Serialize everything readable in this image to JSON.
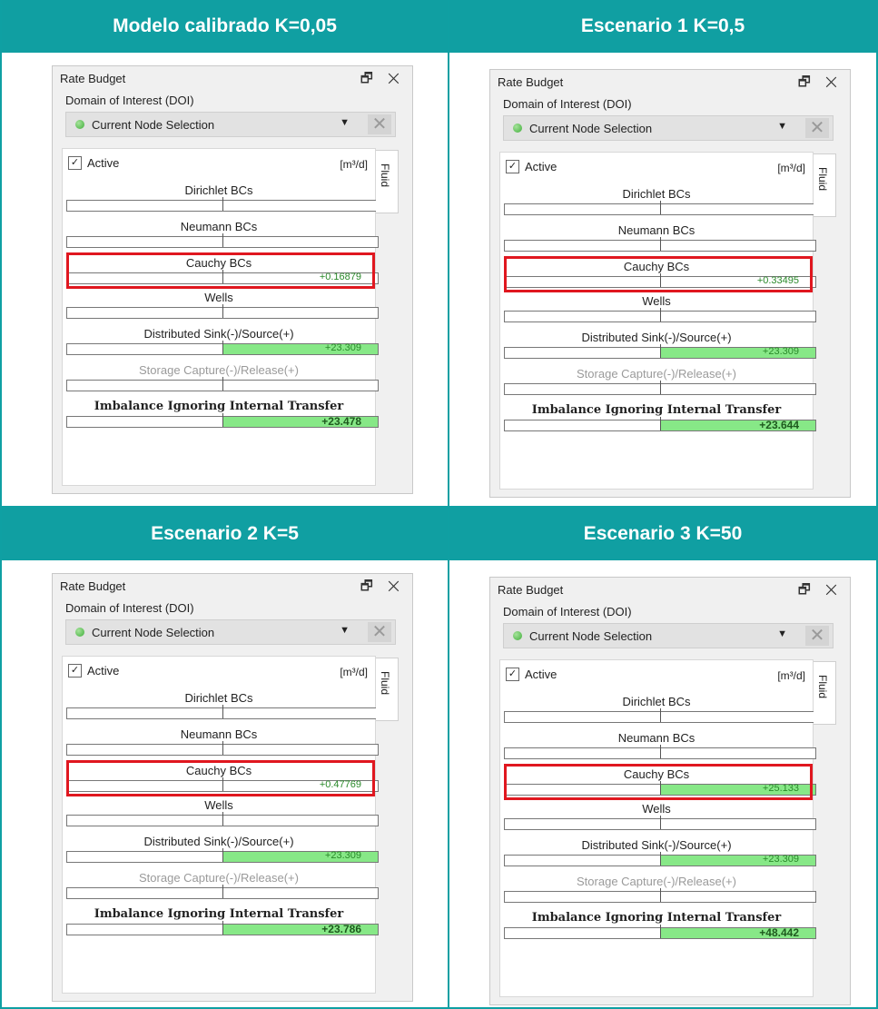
{
  "panels": [
    {
      "heading": "Modelo calibrado K=0,05",
      "title": "Rate Budget",
      "icons": "🗗 ✕",
      "doi_label": "Domain of Interest (DOI)",
      "selection": "Current Node Selection",
      "active_label": "Active",
      "unit": "[m³/d]",
      "tab": "Fluid",
      "sections": {
        "dirichlet": {
          "label": "Dirichlet BCs",
          "value": "",
          "fraction": 0
        },
        "neumann": {
          "label": "Neumann BCs",
          "value": "",
          "fraction": 0
        },
        "cauchy": {
          "label": "Cauchy BCs",
          "value": "+0.16879",
          "fraction": 0
        },
        "wells": {
          "label": "Wells",
          "value": "",
          "fraction": 0
        },
        "distributed": {
          "label": "Distributed Sink(-)/Source(+)",
          "value": "+23.309",
          "fraction": 1
        },
        "storage": {
          "label": "Storage Capture(-)/Release(+)",
          "value": "",
          "fraction": 0
        },
        "imbalance": {
          "label": "Imbalance Ignoring Internal Transfer",
          "value": "+23.478",
          "fraction": 1
        }
      }
    },
    {
      "heading": "Escenario 1 K=0,5",
      "title": "Rate Budget",
      "icons": "🗗 ✕",
      "doi_label": "Domain of Interest (DOI)",
      "selection": "Current Node Selection",
      "active_label": "Active",
      "unit": "[m³/d]",
      "tab": "Fluid",
      "sections": {
        "dirichlet": {
          "label": "Dirichlet BCs",
          "value": "",
          "fraction": 0
        },
        "neumann": {
          "label": "Neumann BCs",
          "value": "",
          "fraction": 0
        },
        "cauchy": {
          "label": "Cauchy BCs",
          "value": "+0.33495",
          "fraction": 0
        },
        "wells": {
          "label": "Wells",
          "value": "",
          "fraction": 0
        },
        "distributed": {
          "label": "Distributed Sink(-)/Source(+)",
          "value": "+23.309",
          "fraction": 1
        },
        "storage": {
          "label": "Storage Capture(-)/Release(+)",
          "value": "",
          "fraction": 0
        },
        "imbalance": {
          "label": "Imbalance Ignoring Internal Transfer",
          "value": "+23.644",
          "fraction": 1
        }
      }
    },
    {
      "heading": "Escenario 2 K=5",
      "title": "Rate Budget",
      "icons": "🗗 ✕",
      "doi_label": "Domain of Interest (DOI)",
      "selection": "Current Node Selection",
      "active_label": "Active",
      "unit": "[m³/d]",
      "tab": "Fluid",
      "sections": {
        "dirichlet": {
          "label": "Dirichlet BCs",
          "value": "",
          "fraction": 0
        },
        "neumann": {
          "label": "Neumann BCs",
          "value": "",
          "fraction": 0
        },
        "cauchy": {
          "label": "Cauchy BCs",
          "value": "+0.47769",
          "fraction": 0
        },
        "wells": {
          "label": "Wells",
          "value": "",
          "fraction": 0
        },
        "distributed": {
          "label": "Distributed Sink(-)/Source(+)",
          "value": "+23.309",
          "fraction": 1
        },
        "storage": {
          "label": "Storage Capture(-)/Release(+)",
          "value": "",
          "fraction": 0
        },
        "imbalance": {
          "label": "Imbalance Ignoring Internal Transfer",
          "value": "+23.786",
          "fraction": 1
        }
      }
    },
    {
      "heading": "Escenario 3 K=50",
      "title": "Rate Budget",
      "icons": "🗗 ✕",
      "doi_label": "Domain of Interest (DOI)",
      "selection": "Current Node Selection",
      "active_label": "Active",
      "unit": "[m³/d]",
      "tab": "Fluid",
      "sections": {
        "dirichlet": {
          "label": "Dirichlet BCs",
          "value": "",
          "fraction": 0
        },
        "neumann": {
          "label": "Neumann BCs",
          "value": "",
          "fraction": 0
        },
        "cauchy": {
          "label": "Cauchy BCs",
          "value": "+25.133",
          "fraction": 1
        },
        "wells": {
          "label": "Wells",
          "value": "",
          "fraction": 0
        },
        "distributed": {
          "label": "Distributed Sink(-)/Source(+)",
          "value": "+23.309",
          "fraction": 1
        },
        "storage": {
          "label": "Storage Capture(-)/Release(+)",
          "value": "",
          "fraction": 0
        },
        "imbalance": {
          "label": "Imbalance Ignoring Internal Transfer",
          "value": "+48.442",
          "fraction": 1
        }
      }
    }
  ],
  "colors": {
    "header_teal": "#109fa2",
    "highlight_red": "#e0171f",
    "bar_green": "#87e887"
  }
}
